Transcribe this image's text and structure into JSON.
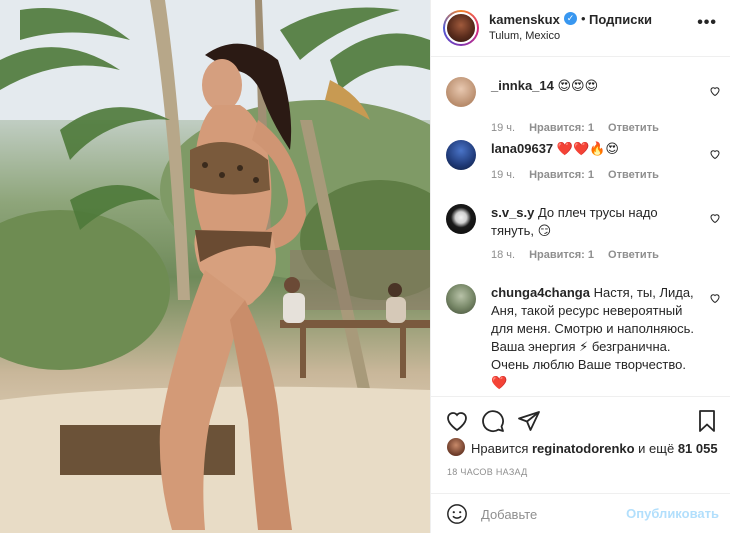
{
  "header": {
    "username": "kamenskux",
    "dot": "•",
    "follow_label": "Подписки",
    "location": "Tulum, Mexico",
    "more": "•••"
  },
  "comments": [
    {
      "user": "_innka_14",
      "text": " 😍😍😍",
      "time": "19 ч.",
      "likes": "Нравится: 1",
      "reply": "Ответить",
      "avatar_color": "#c9a58a"
    },
    {
      "user": "lana09637",
      "text": " ❤️❤️🔥😍",
      "time": "19 ч.",
      "likes": "Нравится: 1",
      "reply": "Ответить",
      "avatar_color": "#1f3a78"
    },
    {
      "user": "s.v_s.y",
      "text": " До плеч трусы надо тянуть, 😏",
      "time": "18 ч.",
      "likes": "Нравится: 1",
      "reply": "Ответить",
      "avatar_color": "#1a1a1a"
    },
    {
      "user": "chunga4changa",
      "text": " Настя, ты, Лида, Аня, такой ресурс невероятный для меня. Смотрю и наполняюсь. Ваша энергия ⚡ безгранична. Очень люблю Ваше творчество. ❤️",
      "avatar_color": "#7a8a6a"
    }
  ],
  "actions": {
    "likes_prefix": "Нравится ",
    "likes_user": "reginatodorenko",
    "likes_mid": " и ещё ",
    "likes_count": "81 055",
    "post_time": "18 ЧАСОВ НАЗАД"
  },
  "add_comment": {
    "placeholder": "Добавьте",
    "publish_label": "Опубликовать"
  },
  "colors": {
    "accent": "#3897f0",
    "publish_disabled": "#b2dffc",
    "meta": "#8e8e8e"
  }
}
